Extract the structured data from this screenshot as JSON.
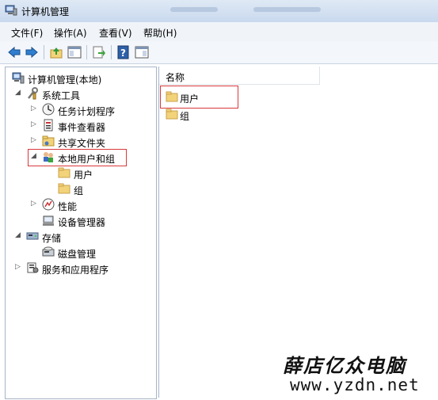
{
  "window": {
    "title": "计算机管理"
  },
  "menu": [
    {
      "label": "文件(F)"
    },
    {
      "label": "操作(A)"
    },
    {
      "label": "查看(V)"
    },
    {
      "label": "帮助(H)"
    }
  ],
  "toolbar": {
    "buttons": [
      {
        "icon": "back-arrow-icon"
      },
      {
        "icon": "forward-arrow-icon"
      },
      {
        "icon": "up-folder-icon"
      },
      {
        "icon": "show-hide-console-tree-icon"
      },
      {
        "icon": "export-list-icon"
      },
      {
        "icon": "help-icon"
      },
      {
        "icon": "show-hide-action-pane-icon"
      }
    ]
  },
  "tree": {
    "root": "计算机管理(本地)",
    "system_tools": "系统工具",
    "task_scheduler": "任务计划程序",
    "event_viewer": "事件查看器",
    "shared_folders": "共享文件夹",
    "local_users_groups": "本地用户和组",
    "users": "用户",
    "groups": "组",
    "performance": "性能",
    "device_manager": "设备管理器",
    "storage": "存储",
    "disk_management": "磁盘管理",
    "services_apps": "服务和应用程序"
  },
  "list": {
    "column_name": "名称",
    "items": [
      {
        "label": "用户"
      },
      {
        "label": "组"
      }
    ]
  },
  "watermark": {
    "chinese": "薛店亿众电脑",
    "url": "www.yzdn.net"
  },
  "colors": {
    "highlight_red": "#d9383a",
    "title_bar": "#dfe9f5",
    "folder": "#f3d37a"
  }
}
